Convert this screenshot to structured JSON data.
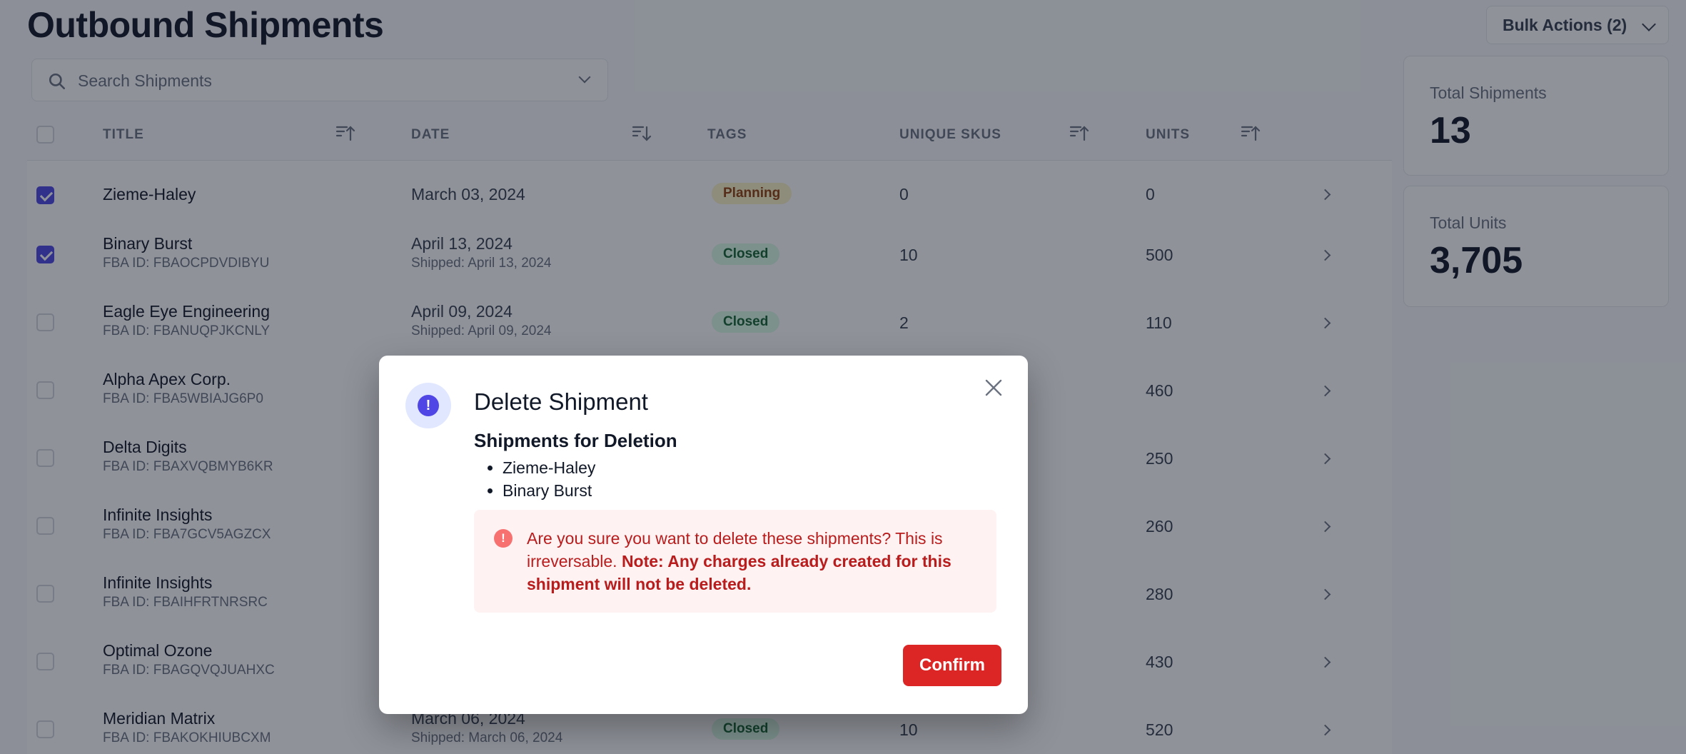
{
  "page": {
    "title": "Outbound Shipments",
    "bulk_actions_label": "Bulk Actions (2)"
  },
  "search": {
    "placeholder": "Search Shipments"
  },
  "table": {
    "columns": {
      "title": "TITLE",
      "date": "DATE",
      "tags": "TAGS",
      "skus": "UNIQUE SKUS",
      "units": "UNITS"
    },
    "rows": [
      {
        "title": "Zieme-Haley",
        "fba": "",
        "date": "March 03, 2024",
        "shipped": "",
        "tag": "Planning",
        "skus": "0",
        "units": "0",
        "checked": true
      },
      {
        "title": "Binary Burst",
        "fba": "FBA ID: FBAOCPDVDIBYU",
        "date": "April 13, 2024",
        "shipped": "Shipped: April 13, 2024",
        "tag": "Closed",
        "skus": "10",
        "units": "500",
        "checked": true
      },
      {
        "title": "Eagle Eye Engineering",
        "fba": "FBA ID: FBANUQPJKCNLY",
        "date": "April 09, 2024",
        "shipped": "Shipped: April 09, 2024",
        "tag": "Closed",
        "skus": "2",
        "units": "110",
        "checked": false
      },
      {
        "title": "Alpha Apex Corp.",
        "fba": "FBA ID: FBA5WBIAJG6P0",
        "date": "",
        "shipped": "",
        "tag": "",
        "skus": "",
        "units": "460",
        "checked": false
      },
      {
        "title": "Delta Digits",
        "fba": "FBA ID: FBAXVQBMYB6KR",
        "date": "",
        "shipped": "",
        "tag": "",
        "skus": "",
        "units": "250",
        "checked": false
      },
      {
        "title": "Infinite Insights",
        "fba": "FBA ID: FBA7GCV5AGZCX",
        "date": "",
        "shipped": "",
        "tag": "",
        "skus": "",
        "units": "260",
        "checked": false
      },
      {
        "title": "Infinite Insights",
        "fba": "FBA ID: FBAIHFRTNRSRC",
        "date": "",
        "shipped": "",
        "tag": "",
        "skus": "",
        "units": "280",
        "checked": false
      },
      {
        "title": "Optimal Ozone",
        "fba": "FBA ID: FBAGQVQJUAHXC",
        "date": "",
        "shipped": "",
        "tag": "",
        "skus": "",
        "units": "430",
        "checked": false
      },
      {
        "title": "Meridian Matrix",
        "fba": "FBA ID: FBAKOKHIUBCXM",
        "date": "March 06, 2024",
        "shipped": "Shipped: March 06, 2024",
        "tag": "Closed",
        "skus": "10",
        "units": "520",
        "checked": false
      }
    ]
  },
  "stats": [
    {
      "label": "Total Shipments",
      "value": "13"
    },
    {
      "label": "Total Units",
      "value": "3,705"
    }
  ],
  "modal": {
    "title": "Delete Shipment",
    "subtitle": "Shipments for Deletion",
    "items": [
      "Zieme-Haley",
      "Binary Burst"
    ],
    "alert_text": "Are you sure you want to delete these shipments? This is irreversable.",
    "alert_note": "Note: Any charges already created for this shipment will not be deleted.",
    "confirm_label": "Confirm"
  },
  "colors": {
    "accent": "#4f46e5",
    "danger": "#dc2626",
    "overlay": "#6b7280"
  },
  "icons": {
    "search": "search-icon",
    "close": "close-icon",
    "alert": "exclamation-icon"
  }
}
